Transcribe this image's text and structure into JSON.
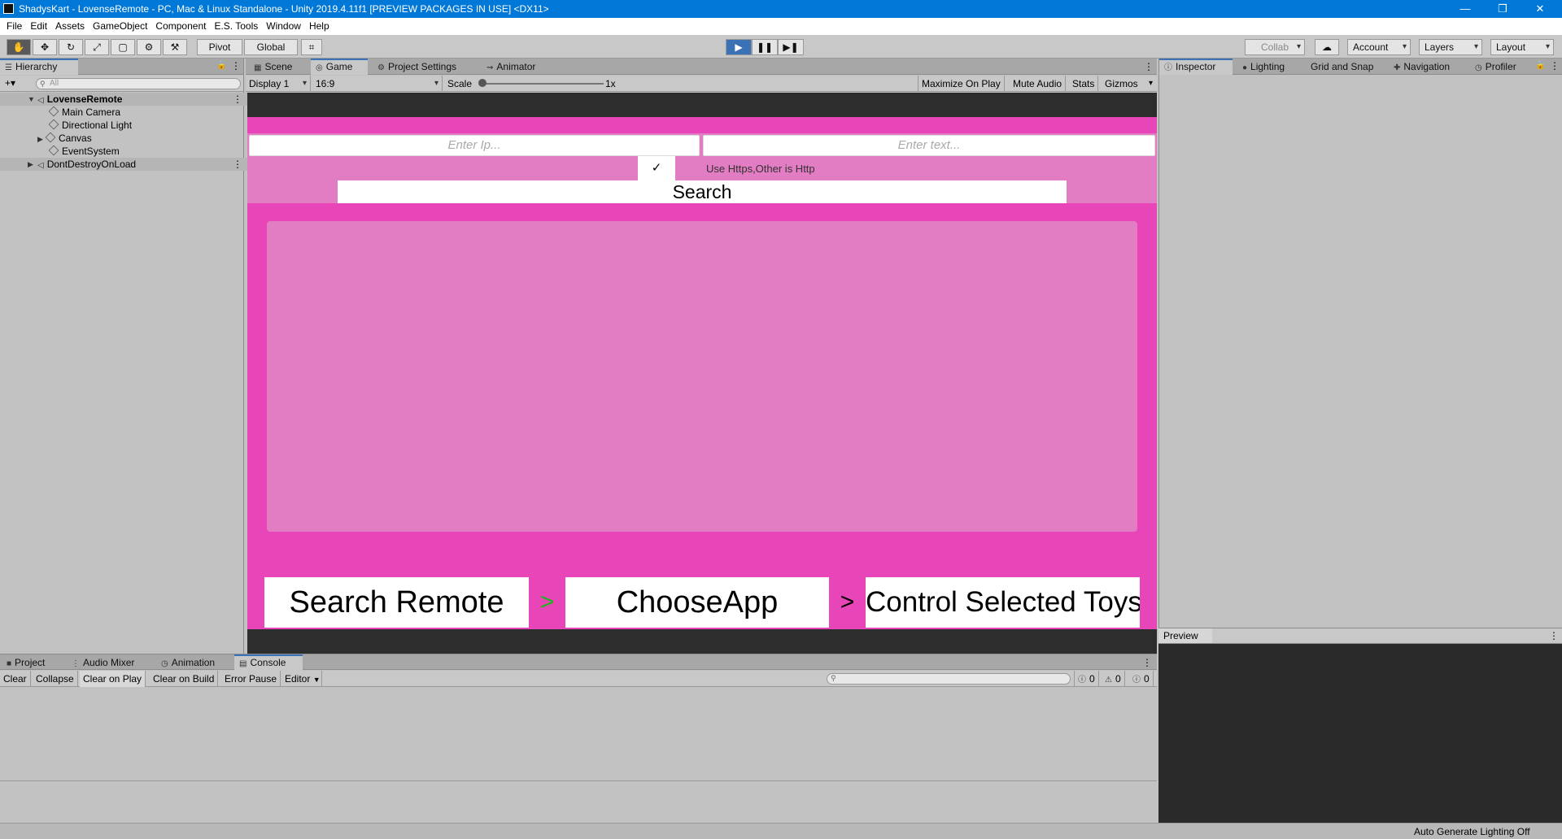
{
  "window": {
    "title": "ShadysKart - LovenseRemote - PC, Mac & Linux Standalone - Unity 2019.4.11f1 [PREVIEW PACKAGES IN USE] <DX11>",
    "minimize": "—",
    "restore": "❐",
    "close": "✕"
  },
  "menu": [
    "File",
    "Edit",
    "Assets",
    "GameObject",
    "Component",
    "E.S. Tools",
    "Window",
    "Help"
  ],
  "toolbar": {
    "tools": [
      "✋",
      "✥",
      "↻",
      "⤢",
      "▢",
      "⚙",
      "⚒"
    ],
    "pivot": "Pivot",
    "global": "Global",
    "grid_icon": "⌗",
    "play": "▶",
    "pause": "❚❚",
    "step": "▶❚",
    "collab": "Collab",
    "cloud": "☁",
    "account": "Account",
    "layers": "Layers",
    "layout": "Layout"
  },
  "hierarchy": {
    "tab": "Hierarchy",
    "add": "+▾",
    "search_placeholder": "All",
    "items": [
      {
        "label": "LovenseRemote",
        "bold": true
      },
      {
        "label": "Main Camera"
      },
      {
        "label": "Directional Light"
      },
      {
        "label": "Canvas"
      },
      {
        "label": "EventSystem"
      },
      {
        "label": "DontDestroyOnLoad"
      }
    ]
  },
  "center_tabs": [
    "Scene",
    "Game",
    "Project Settings",
    "Animator"
  ],
  "game_toolbar": {
    "display": "Display 1",
    "aspect": "16:9",
    "scale_label": "Scale",
    "scale_value": "1x",
    "maximize": "Maximize On Play",
    "mute": "Mute Audio",
    "stats": "Stats",
    "gizmos": "Gizmos"
  },
  "game": {
    "ip_placeholder": "Enter Ip...",
    "text_placeholder": "Enter text...",
    "checkbox_checked": true,
    "checkbox_mark": "✓",
    "https_label": "Use Https,Other is Http",
    "search_button": "Search",
    "step1": "Search Remote",
    "step2": "ChooseApp",
    "step3": "Control Selected Toys",
    "sep1": ">",
    "sep2": ">",
    "colors": {
      "canvas": "#e845b8",
      "panel": "#e27cc3",
      "sep1": "#1db41d",
      "sep2": "#000000"
    }
  },
  "right_tabs": [
    "Inspector",
    "Lighting",
    "Grid and Snap",
    "Navigation",
    "Profiler"
  ],
  "preview_label": "Preview",
  "bottom_tabs": [
    "Project",
    "Audio Mixer",
    "Animation",
    "Console"
  ],
  "console": {
    "buttons": [
      "Clear",
      "Collapse",
      "Clear on Play",
      "Clear on Build",
      "Error Pause",
      "Editor"
    ],
    "search_placeholder": "",
    "counts": {
      "info": "0",
      "warn": "0",
      "error": "0"
    }
  },
  "status": "Auto Generate Lighting Off"
}
